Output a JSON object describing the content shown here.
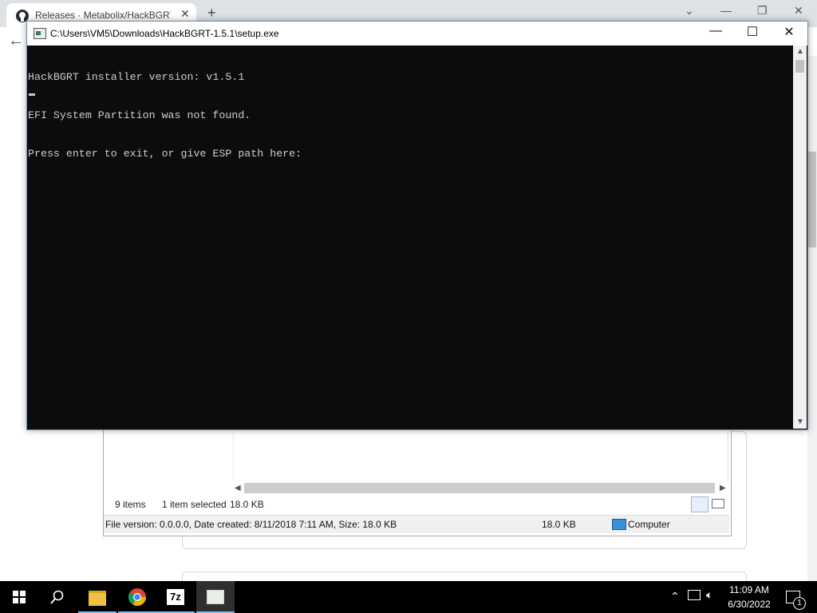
{
  "browser": {
    "tab_title": "Releases · Metabolix/HackBGRT ·",
    "tab_close": "✕",
    "new_tab": "+",
    "back": "←"
  },
  "explorer": {
    "items_count": "9 items",
    "selected": "1 item selected",
    "selected_size": "18.0 KB",
    "info": "File version: 0.0.0.0, Date created: 8/11/2018 7:11 AM, Size: 18.0 KB",
    "info_size": "18.0 KB",
    "location": "Computer"
  },
  "console": {
    "title": "C:\\Users\\VM5\\Downloads\\HackBGRT-1.5.1\\setup.exe",
    "lines": [
      "HackBGRT installer version: v1.5.1",
      "EFI System Partition was not found.",
      "Press enter to exit, or give ESP path here:"
    ],
    "controls": {
      "minimize": "—",
      "maximize": "☐",
      "close": "✕"
    }
  },
  "taskbar": {
    "time": "11:09 AM",
    "date": "6/30/2022",
    "notification_count": "1"
  }
}
